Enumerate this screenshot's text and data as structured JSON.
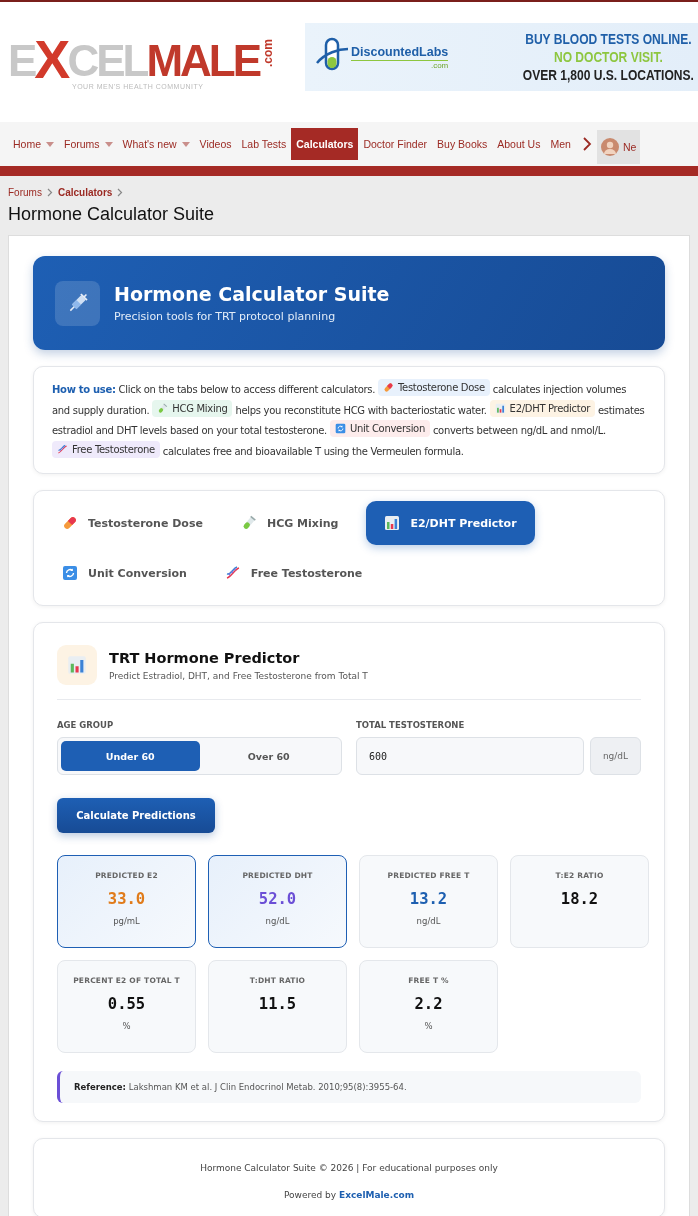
{
  "logo": {
    "letter": "E",
    "x_letter": "X",
    "rest": "CEL",
    "male": "MALE",
    "tld": ".com",
    "tagline": "YOUR MEN'S HEALTH COMMUNITY"
  },
  "ad": {
    "brand": "DiscountedLabs",
    "brand_tld": ".com",
    "lines": [
      {
        "text": "BUY BLOOD TESTS ONLINE.",
        "color": "#1f5fa8"
      },
      {
        "text": "NO DOCTOR VISIT.",
        "color": "#8dc63f"
      },
      {
        "text": "OVER 1,800 U.S. LOCATIONS.",
        "color": "#222222"
      }
    ]
  },
  "nav": {
    "items": [
      {
        "label": "Home",
        "dropdown": true,
        "selected": false
      },
      {
        "label": "Forums",
        "dropdown": true,
        "selected": false
      },
      {
        "label": "What's new",
        "dropdown": true,
        "selected": false
      },
      {
        "label": "Videos",
        "dropdown": false,
        "selected": false
      },
      {
        "label": "Lab Tests",
        "dropdown": false,
        "selected": false
      },
      {
        "label": "Calculators",
        "dropdown": false,
        "selected": true
      },
      {
        "label": "Doctor Finder",
        "dropdown": false,
        "selected": false
      },
      {
        "label": "Buy Books",
        "dropdown": false,
        "selected": false
      },
      {
        "label": "About Us",
        "dropdown": false,
        "selected": false
      },
      {
        "label": "Men",
        "dropdown": false,
        "selected": false
      }
    ],
    "user": "Ne"
  },
  "breadcrumbs": [
    {
      "label": "Forums",
      "current": false
    },
    {
      "label": "Calculators",
      "current": true
    }
  ],
  "page_title": "Hormone Calculator Suite",
  "hero": {
    "title": "Hormone Calculator Suite",
    "subtitle": "Precision tools for TRT protocol planning"
  },
  "how_to": {
    "lead": "How to use:",
    "segments": [
      {
        "kind": "text",
        "text": "Click on the tabs below to access different calculators."
      },
      {
        "kind": "chip",
        "text": "Testosterone Dose",
        "color": "#e8f1fc"
      },
      {
        "kind": "text",
        "text": "calculates injection volumes and supply duration."
      },
      {
        "kind": "chip",
        "text": "HCG Mixing",
        "color": "#e6f6ee"
      },
      {
        "kind": "text",
        "text": "helps you reconstitute HCG with bacteriostatic water."
      },
      {
        "kind": "chip",
        "text": "E2/DHT Predictor",
        "color": "#fdf3e4"
      },
      {
        "kind": "text",
        "text": "estimates estradiol and DHT levels based on your total testosterone."
      },
      {
        "kind": "chip",
        "text": "Unit Conversion",
        "color": "#fdecec"
      },
      {
        "kind": "text",
        "text": "converts between ng/dL and nmol/L."
      },
      {
        "kind": "chip",
        "text": "Free Testosterone",
        "color": "#efeafb"
      },
      {
        "kind": "text",
        "text": "calculates free and bioavailable T using the Vermeulen formula."
      }
    ]
  },
  "tabs": [
    {
      "label": "Testosterone Dose",
      "selected": false
    },
    {
      "label": "HCG Mixing",
      "selected": false
    },
    {
      "label": "E2/DHT Predictor",
      "selected": true
    },
    {
      "label": "Unit Conversion",
      "selected": false
    },
    {
      "label": "Free Testosterone",
      "selected": false
    }
  ],
  "calculator": {
    "title": "TRT Hormone Predictor",
    "subtitle": "Predict Estradiol, DHT, and Free Testosterone from Total T",
    "age_group": {
      "label": "AGE GROUP",
      "options": [
        {
          "label": "Under 60",
          "selected": true
        },
        {
          "label": "Over 60",
          "selected": false
        }
      ]
    },
    "total_t": {
      "label": "TOTAL TESTOSTERONE",
      "value": "600",
      "unit": "ng/dL"
    },
    "button": "Calculate Predictions",
    "results": [
      {
        "label": "PREDICTED E2",
        "value": "33.0",
        "unit": "pg/mL",
        "color": "#e07b1a",
        "highlighted": true
      },
      {
        "label": "PREDICTED DHT",
        "value": "52.0",
        "unit": "ng/dL",
        "color": "#6b4fd6",
        "highlighted": true
      },
      {
        "label": "PREDICTED FREE T",
        "value": "13.2",
        "unit": "ng/dL",
        "color": "#1d5fb0",
        "highlighted": false
      },
      {
        "label": "T:E2 RATIO",
        "value": "18.2",
        "color": "#111111",
        "highlighted": false
      },
      {
        "label": "PERCENT E2 OF TOTAL T",
        "value": "0.55",
        "unit": "%",
        "color": "#111111",
        "highlighted": false
      },
      {
        "label": "T:DHT RATIO",
        "value": "11.5",
        "color": "#111111",
        "highlighted": false
      },
      {
        "label": "FREE T %",
        "value": "2.2",
        "unit": "%",
        "color": "#111111",
        "highlighted": false
      }
    ],
    "reference": "**Reference:** Lakshman KM et al. J Clin Endocrinol Metab. 2010;95(8):3955-64."
  },
  "footer": {
    "text": "Hormone Calculator Suite © 2026 | For educational purposes only",
    "powered_by": "Powered by",
    "link": "ExcelMale.com"
  }
}
